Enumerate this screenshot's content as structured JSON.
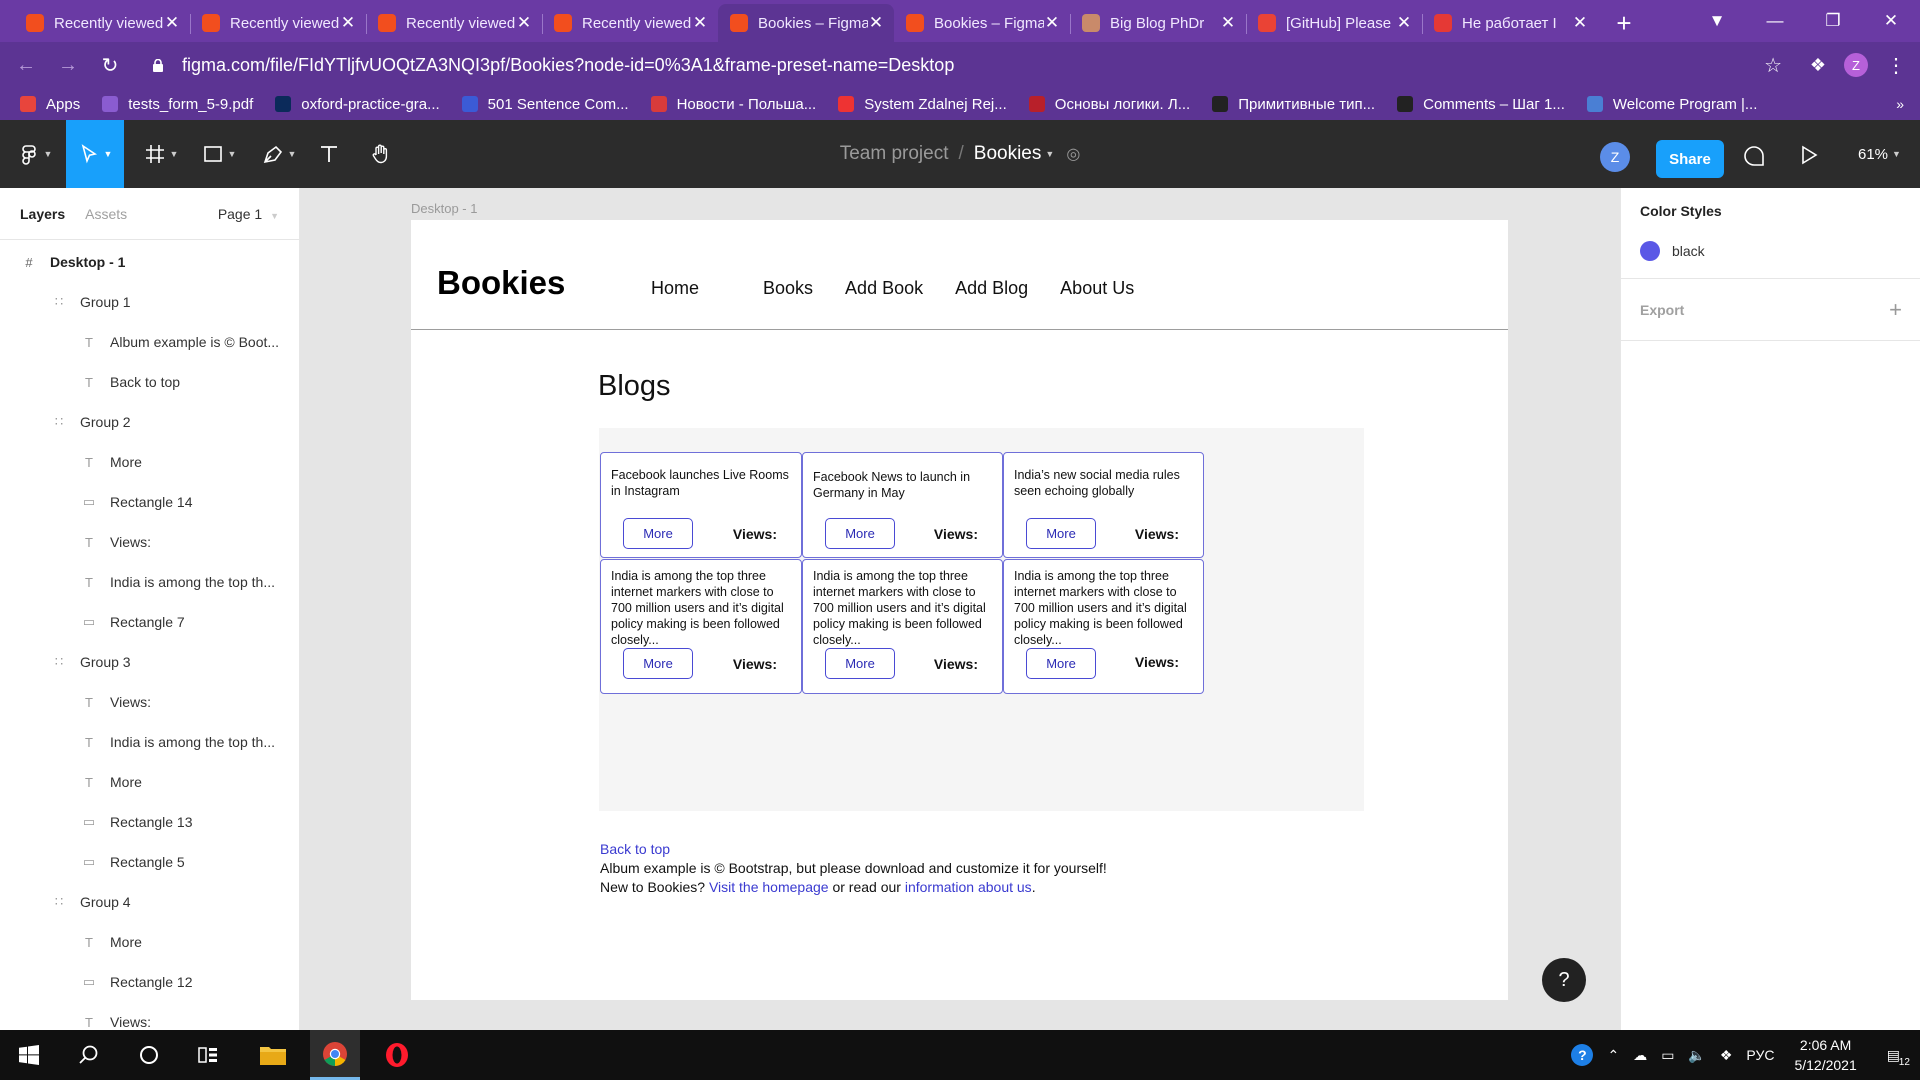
{
  "browser": {
    "tabs": [
      {
        "title": "Recently viewed",
        "favicon": "figma-icon"
      },
      {
        "title": "Recently viewed",
        "favicon": "figma-icon"
      },
      {
        "title": "Recently viewed",
        "favicon": "figma-icon"
      },
      {
        "title": "Recently viewed",
        "favicon": "figma-icon"
      },
      {
        "title": "Bookies – Figma",
        "favicon": "figma-icon",
        "active": true
      },
      {
        "title": "Bookies – Figma",
        "favicon": "figma-icon"
      },
      {
        "title": "Big Blog PhDr",
        "favicon": "avatar-icon"
      },
      {
        "title": "[GitHub] Please",
        "favicon": "gmail-icon"
      },
      {
        "title": "Не работает I",
        "favicon": "red-icon"
      }
    ],
    "url": "figma.com/file/FIdYTljfvUOQtZA3NQI3pf/Bookies?node-id=0%3A1&frame-preset-name=Desktop",
    "profile_initial": "Z",
    "bookmarks": [
      {
        "label": "Apps",
        "color": "#e8453c"
      },
      {
        "label": "tests_form_5-9.pdf",
        "color": "#8a5cd0"
      },
      {
        "label": "oxford-practice-gra...",
        "color": "#0b2a5a"
      },
      {
        "label": "501 Sentence Com...",
        "color": "#3b5bd6"
      },
      {
        "label": "Новости - Польша...",
        "color": "#d93b3b"
      },
      {
        "label": "System Zdalnej Rej...",
        "color": "#e33"
      },
      {
        "label": "Основы логики. Л...",
        "color": "#b8202a"
      },
      {
        "label": "Примитивные тип...",
        "color": "#222222"
      },
      {
        "label": "Comments – Шаг 1...",
        "color": "#222222"
      },
      {
        "label": "Welcome Program |...",
        "color": "#4a7fd4"
      }
    ]
  },
  "figma": {
    "team": "Team project",
    "file": "Bookies",
    "user_initial": "Z",
    "share_label": "Share",
    "zoom": "61%",
    "layers_tab": "Layers",
    "assets_tab": "Assets",
    "page": "Page 1",
    "layers": [
      {
        "name": "Desktop - 1",
        "level": 0,
        "icon": "#"
      },
      {
        "name": "Group 1",
        "level": 1,
        "icon": "group"
      },
      {
        "name": "Album example is © Boot...",
        "level": 2,
        "icon": "T"
      },
      {
        "name": "Back to top",
        "level": 2,
        "icon": "T"
      },
      {
        "name": "Group 2",
        "level": 1,
        "icon": "group"
      },
      {
        "name": "More",
        "level": 2,
        "icon": "T"
      },
      {
        "name": "Rectangle 14",
        "level": 2,
        "icon": "rect"
      },
      {
        "name": "Views:",
        "level": 2,
        "icon": "T"
      },
      {
        "name": "India is among the top th...",
        "level": 2,
        "icon": "T"
      },
      {
        "name": "Rectangle 7",
        "level": 2,
        "icon": "rect"
      },
      {
        "name": "Group 3",
        "level": 1,
        "icon": "group"
      },
      {
        "name": "Views:",
        "level": 2,
        "icon": "T"
      },
      {
        "name": "India is among the top th...",
        "level": 2,
        "icon": "T"
      },
      {
        "name": "More",
        "level": 2,
        "icon": "T"
      },
      {
        "name": "Rectangle 13",
        "level": 2,
        "icon": "rect"
      },
      {
        "name": "Rectangle 5",
        "level": 2,
        "icon": "rect"
      },
      {
        "name": "Group 4",
        "level": 1,
        "icon": "group"
      },
      {
        "name": "More",
        "level": 2,
        "icon": "T"
      },
      {
        "name": "Rectangle 12",
        "level": 2,
        "icon": "rect"
      },
      {
        "name": "Views:",
        "level": 2,
        "icon": "T"
      }
    ],
    "frame_label": "Desktop - 1",
    "color_styles_title": "Color Styles",
    "color_style": {
      "name": "black",
      "color": "#5a58e6"
    },
    "export_label": "Export"
  },
  "site": {
    "brand": "Bookies",
    "nav": [
      "Home",
      "Books",
      "Add Book",
      "Add Blog",
      "About Us"
    ],
    "section_title": "Blogs",
    "cards": [
      {
        "text": "Facebook launches Live Rooms in Instagram",
        "more": "More",
        "views": "Views:"
      },
      {
        "text": "Facebook News to launch in Germany in May",
        "more": "More",
        "views": "Views:"
      },
      {
        "text": "India’s new social media rules seen echoing globally",
        "more": "More",
        "views": "Views:"
      },
      {
        "text": "India is among the top three internet markers with close to 700 million users and it’s digital policy making is been followed closely...",
        "more": "More",
        "views": "Views:"
      },
      {
        "text": "India is among the top three internet markers with close to 700 million users and it’s digital policy making is been followed closely...",
        "more": "More",
        "views": "Views:"
      },
      {
        "text": "India is among the top three internet markers with close to 700 million users and it’s digital policy making is been followed closely...",
        "more": "More",
        "views": "Views:"
      }
    ],
    "footer": {
      "back_to_top": "Back to top",
      "album_line": "Album example is © Bootstrap, but please download and customize it for yourself!",
      "new_prefix": "New to Bookies?",
      "visit_link": "Visit the homepage",
      "or_read": "or read our",
      "info_link": "information about us",
      "period": "."
    },
    "help": "?"
  },
  "taskbar": {
    "lang": "РУС",
    "time": "2:06 AM",
    "date": "5/12/2021",
    "notifications": "12"
  }
}
